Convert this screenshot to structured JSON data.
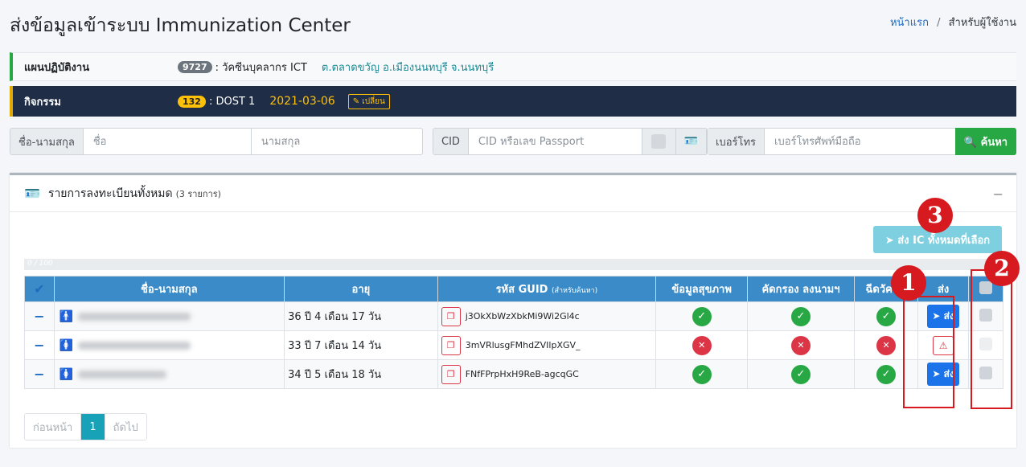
{
  "page": {
    "title": "ส่งข้อมูลเข้าระบบ Immunization Center",
    "breadcrumb": {
      "home": "หน้าแรก",
      "sep": "/",
      "current": "สำหรับผู้ใช้งาน"
    }
  },
  "plan": {
    "label": "แผนปฏิบัติงาน",
    "badge": "9727",
    "text": ": วัคซีนบุคลากร ICT",
    "location": "ต.ตลาดขวัญ อ.เมืองนนทบุรี จ.นนทบุรี"
  },
  "activity": {
    "label": "กิจกรรม",
    "badge": "132",
    "text": ": DOST 1",
    "date": "2021-03-06",
    "change_label": "เปลี่ยน"
  },
  "search": {
    "name_label": "ชื่อ-นามสกุล",
    "first_placeholder": "ชื่อ",
    "last_placeholder": "นามสกุล",
    "cid_label": "CID",
    "cid_placeholder": "CID หรือเลข Passport",
    "phone_label": "เบอร์โทร",
    "phone_placeholder": "เบอร์โทรศัพท์มือถือ",
    "button": "ค้นหา"
  },
  "list": {
    "title": "รายการลงทะเบียนทั้งหมด",
    "count": "(3 รายการ)",
    "collapse": "−",
    "send_all": "ส่ง IC ทั้งหมดที่เลือก",
    "progress_text": "0 / 100",
    "progress_value": 0,
    "columns": {
      "check": "✔",
      "name": "ชื่อ-นามสกุล",
      "age": "อายุ",
      "guid": "รหัส GUID",
      "guid_note": "(สำหรับค้นหา)",
      "health": "ข้อมูลสุขภาพ",
      "screen": "คัดกรอง ลงนามฯ",
      "vaccine": "ฉีดวัคซีน",
      "send": "ส่ง"
    },
    "rows": [
      {
        "gender": "male",
        "age": "36 ปี 4 เดือน 17 วัน",
        "guid": "j3OkXbWzXbkMi9Wi2Gl4c",
        "health": true,
        "screen": true,
        "vaccine": true,
        "send_label": "ส่ง",
        "can_send": true
      },
      {
        "gender": "female",
        "age": "33 ปี 7 เดือน 14 วัน",
        "guid": "3mVRlusgFMhdZVIlpXGV_",
        "health": false,
        "screen": false,
        "vaccine": false,
        "send_label": "",
        "can_send": false
      },
      {
        "gender": "female",
        "age": "34 ปี 5 เดือน 18 วัน",
        "guid": "FNfFPrpHxH9ReB-agcqGC",
        "health": true,
        "screen": true,
        "vaccine": true,
        "send_label": "ส่ง",
        "can_send": true
      }
    ]
  },
  "pagination": {
    "prev": "ก่อนหน้า",
    "current": "1",
    "next": "ถัดไป"
  },
  "annotations": [
    "1",
    "2",
    "3"
  ],
  "colors": {
    "accent": "#3a8bc8",
    "success": "#28a745",
    "danger": "#dc3545",
    "annotation": "#d71920"
  }
}
